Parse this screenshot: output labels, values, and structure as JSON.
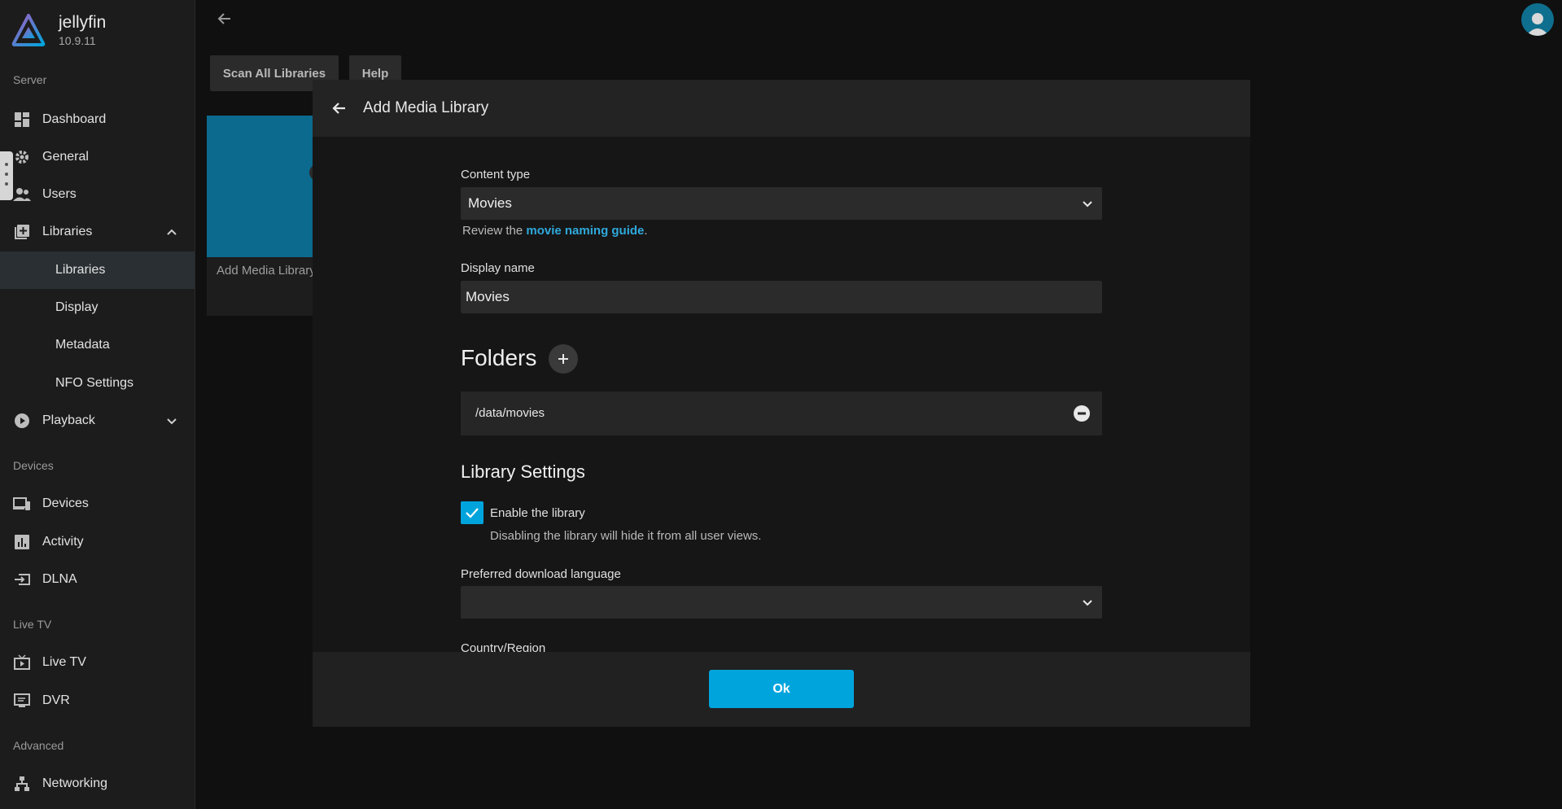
{
  "brand": {
    "name": "jellyfin",
    "version": "10.9.11"
  },
  "sidebar": {
    "sections": {
      "server": "Server",
      "devices": "Devices",
      "livetv": "Live TV",
      "advanced": "Advanced"
    },
    "items": {
      "dashboard": "Dashboard",
      "general": "General",
      "users": "Users",
      "libraries": "Libraries",
      "libraries_sub": "Libraries",
      "display": "Display",
      "metadata": "Metadata",
      "nfo": "NFO Settings",
      "playback": "Playback",
      "devices": "Devices",
      "activity": "Activity",
      "dlna": "DLNA",
      "livetv": "Live TV",
      "dvr": "DVR",
      "networking": "Networking"
    }
  },
  "toolbar": {
    "scan_label": "Scan All Libraries",
    "help_label": "Help"
  },
  "library_card": {
    "label": "Add Media Library"
  },
  "dialog": {
    "title": "Add Media Library",
    "content_type_label": "Content type",
    "content_type_value": "Movies",
    "review_prefix": "Review the ",
    "review_link": "movie naming guide",
    "review_suffix": ".",
    "display_name_label": "Display name",
    "display_name_value": "Movies",
    "folders_heading": "Folders",
    "folders": [
      "/data/movies"
    ],
    "library_settings_heading": "Library Settings",
    "enable_label": "Enable the library",
    "enable_hint": "Disabling the library will hide it from all user views.",
    "enable_checked": true,
    "pref_lang_label": "Preferred download language",
    "pref_lang_value": "",
    "country_label": "Country/Region",
    "ok_label": "Ok"
  },
  "colors": {
    "accent": "#00a4dc",
    "background": "#101010",
    "sidebar": "#1c1c1c"
  }
}
